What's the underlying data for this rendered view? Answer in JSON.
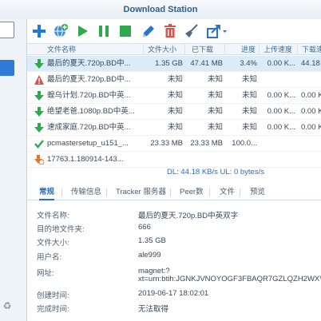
{
  "window": {
    "title": "Download Station"
  },
  "sidebar": {
    "bottom_icon": "recycle-icon"
  },
  "toolbar": {
    "buttons": [
      {
        "name": "add-icon",
        "color": "#1f7ad6"
      },
      {
        "name": "add-url-icon",
        "color": "#1f7ad6"
      },
      {
        "name": "resume-icon",
        "color": "#2fa84f"
      },
      {
        "name": "pause-icon",
        "color": "#2fa84f"
      },
      {
        "name": "stop-icon",
        "color": "#2fa84f"
      },
      {
        "name": "edit-icon",
        "color": "#2f73c9"
      },
      {
        "name": "delete-icon",
        "color": "#d9534f"
      },
      {
        "name": "clear-icon",
        "color": "#4f6a86"
      },
      {
        "name": "share-icon",
        "color": "#2f73c9"
      }
    ]
  },
  "table": {
    "columns": [
      "文件名称",
      "文件大小",
      "已下载",
      "进度",
      "上传速度",
      "下载速"
    ],
    "rows": [
      {
        "icon": "download-icon",
        "name": "最后的夏天.720p.BD中...",
        "size": "1.35 GB",
        "downloaded": "47.41 MB",
        "progress": "3.4%",
        "upload": "0.00 K...",
        "download": "44.18"
      },
      {
        "icon": "error-icon",
        "name": "最后的夏天.720p.BD中...",
        "size": "未知",
        "downloaded": "未知",
        "progress": "未知",
        "upload": "",
        "download": ""
      },
      {
        "icon": "download-icon",
        "name": "蝗乌计划.720p.BD中英...",
        "size": "未知",
        "downloaded": "未知",
        "progress": "未知",
        "upload": "0.00 K...",
        "download": "0.00 K"
      },
      {
        "icon": "download-icon",
        "name": "绝望老爸.1080p.BD中英...",
        "size": "未知",
        "downloaded": "未知",
        "progress": "未知",
        "upload": "0.00 K...",
        "download": "0.00 K"
      },
      {
        "icon": "download-icon",
        "name": "速成家庭.720p.BD中英...",
        "size": "未知",
        "downloaded": "未知",
        "progress": "未知",
        "upload": "0.00 K...",
        "download": "0.00 K"
      },
      {
        "icon": "complete-icon",
        "name": "pcmastersetup_u151_...",
        "size": "23.33 MB",
        "downloaded": "23.33 MB",
        "progress": "100.0...",
        "upload": "",
        "download": ""
      },
      {
        "icon": "waiting-icon",
        "name": "17763.1.180914-143...",
        "size": "",
        "downloaded": "",
        "progress": "",
        "upload": "",
        "download": ""
      }
    ],
    "status": "DL: 44.18 KB/s UL: 0 bytes/s"
  },
  "detail_tabs": [
    "常规",
    "传输信息",
    "Tracker 服务器",
    "Peer数",
    "文件",
    "预览"
  ],
  "details": [
    {
      "label": "文件名称:",
      "value": "最后的夏天.720p.BD中英双字"
    },
    {
      "label": "目的地文件夹:",
      "value": "666"
    },
    {
      "label": "文件大小:",
      "value": "1.35 GB"
    },
    {
      "label": "用户名:",
      "value": "ale999"
    },
    {
      "label": "网址:",
      "value": "magnet:?",
      "value2": "xt=urn:btih:JGNKJVNOYOGF3FBAQR7GZLQZH2WXV2U7"
    },
    {
      "label": "创建时间:",
      "value": "2019-06-17 18:02:01"
    },
    {
      "label": "完成时间:",
      "value": "无法取得"
    }
  ]
}
